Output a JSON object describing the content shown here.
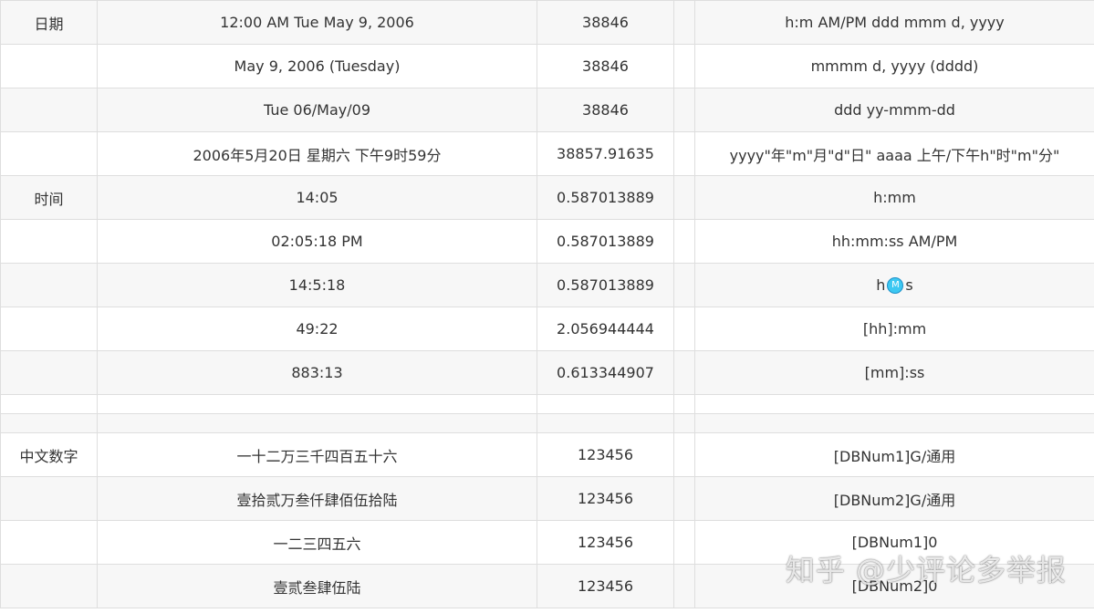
{
  "rows": [
    {
      "category": "日期",
      "display": "12:00 AM Tue May 9, 2006",
      "value": "38846",
      "format": "h:m AM/PM ddd mmm d, yyyy"
    },
    {
      "category": "",
      "display": "May 9, 2006 (Tuesday)",
      "value": "38846",
      "format": "mmmm d, yyyy (dddd)"
    },
    {
      "category": "",
      "display": "Tue 06/May/09",
      "value": "38846",
      "format": "ddd yy-mmm-dd"
    },
    {
      "category": "",
      "display": "2006年5月20日 星期六 下午9时59分",
      "value": "38857.91635",
      "format": "yyyy\"年\"m\"月\"d\"日\" aaaa 上午/下午h\"时\"m\"分\""
    },
    {
      "category": "时间",
      "display": "14:05",
      "value": "0.587013889",
      "format": "h:mm"
    },
    {
      "category": "",
      "display": "02:05:18 PM",
      "value": "0.587013889",
      "format": "hh:mm:ss AM/PM"
    },
    {
      "category": "",
      "display": "14:5:18",
      "value": "0.587013889",
      "format_prefix": "h",
      "format_badge": "M",
      "format_suffix": "s"
    },
    {
      "category": "",
      "display": "49:22",
      "value": "2.056944444",
      "format": "[hh]:mm"
    },
    {
      "category": "",
      "display": "883:13",
      "value": "0.613344907",
      "format": "[mm]:ss"
    },
    {
      "category": "中文数字",
      "display": "一十二万三千四百五十六",
      "value": "123456",
      "format": "[DBNum1]G/通用"
    },
    {
      "category": "",
      "display": "壹拾贰万叁仟肆佰伍拾陆",
      "value": "123456",
      "format": "[DBNum2]G/通用"
    },
    {
      "category": "",
      "display": "一二三四五六",
      "value": "123456",
      "format": "[DBNum1]0"
    },
    {
      "category": "",
      "display": "壹贰叁肆伍陆",
      "value": "123456",
      "format": "[DBNum2]0"
    }
  ],
  "watermark": "知乎 @少评论多举报"
}
